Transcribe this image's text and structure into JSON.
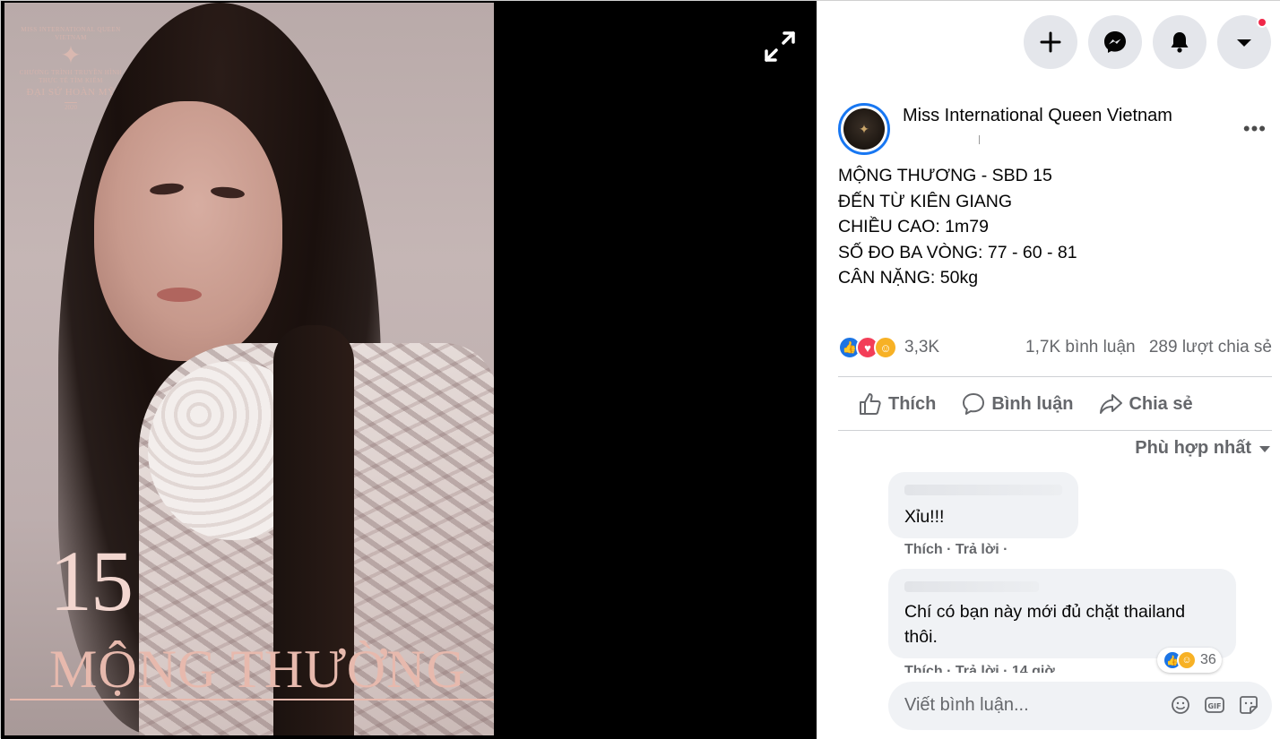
{
  "photo": {
    "logo_lines": [
      "MISS INTERNATIONAL QUEEN VIETNAM",
      "CHƯƠNG TRÌNH TRUYỀN HÌNH THỰC TẾ TÌM KIẾM"
    ],
    "logo_title": "ĐẠI SỨ HOÀN MỸ",
    "logo_year": "2020",
    "number": "15",
    "name": "MỘNG THƯỜNG"
  },
  "viewer": {
    "expand_icon": "expand-icon"
  },
  "topbar": {
    "buttons": [
      {
        "icon": "plus-icon"
      },
      {
        "icon": "messenger-icon"
      },
      {
        "icon": "bell-icon"
      },
      {
        "icon": "caret-down-icon"
      }
    ]
  },
  "post": {
    "page_name": "Miss International Queen Vietnam",
    "caption_lines": [
      "MỘNG THƯƠNG - SBD 15",
      "ĐẾN TỪ KIÊN GIANG",
      "CHIỀU CAO: 1m79",
      "SỐ ĐO BA VÒNG: 77 - 60 - 81",
      "CÂN NẶNG: 50kg"
    ],
    "reaction_count": "3,3K",
    "comment_count": "1,7K bình luận",
    "share_count": "289 lượt chia sẻ",
    "more": "•••"
  },
  "actions": {
    "like": "Thích",
    "comment": "Bình luận",
    "share": "Chia sẻ"
  },
  "sort": {
    "label": "Phù hợp nhất"
  },
  "comments": [
    {
      "text": "Xỉu!!!",
      "like": "Thích",
      "reply": "Trả lời",
      "sep": "·"
    },
    {
      "text_lines": [
        "Chí có bạn này mới đủ chặt thailand",
        "thôi."
      ],
      "like": "Thích",
      "reply": "Trả lời",
      "sep": "·",
      "time": "14 giờ",
      "reactions": "36"
    }
  ],
  "composer": {
    "placeholder": "Viết bình luận...",
    "icons": [
      "emoji-icon",
      "gif-icon",
      "sticker-icon"
    ]
  },
  "colors": {
    "accent": "#1877f2",
    "notification": "#f02849",
    "secondary_text": "#65676b",
    "name_overlay": "#e7b9ad"
  }
}
